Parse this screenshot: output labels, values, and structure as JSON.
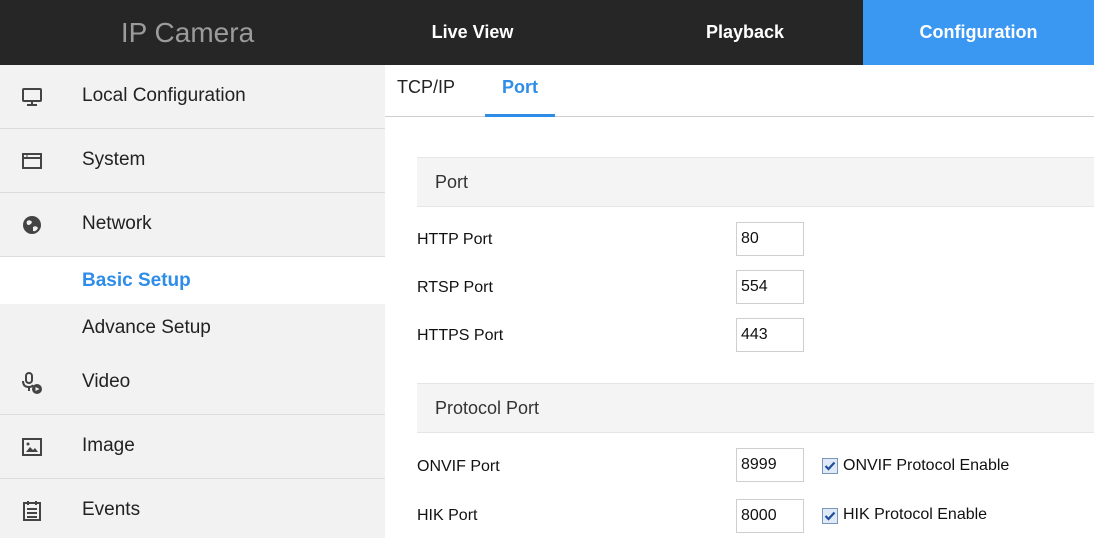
{
  "app": {
    "title": "IP Camera"
  },
  "topnav": {
    "live_view": "Live View",
    "playback": "Playback",
    "configuration": "Configuration"
  },
  "sidebar": {
    "items": [
      {
        "label": "Local Configuration",
        "icon": "monitor-icon"
      },
      {
        "label": "System",
        "icon": "window-icon"
      },
      {
        "label": "Network",
        "icon": "globe-icon"
      },
      {
        "label": "Video",
        "icon": "microphone-video-icon"
      },
      {
        "label": "Image",
        "icon": "image-icon"
      },
      {
        "label": "Events",
        "icon": "calendar-icon"
      }
    ],
    "network_sub": [
      {
        "label": "Basic Setup",
        "active": true
      },
      {
        "label": "Advance Setup",
        "active": false
      }
    ]
  },
  "tabs": [
    {
      "label": "TCP/IP",
      "active": false
    },
    {
      "label": "Port",
      "active": true
    }
  ],
  "port_section": {
    "title": "Port",
    "rows": [
      {
        "label": "HTTP Port",
        "value": "80"
      },
      {
        "label": "RTSP Port",
        "value": "554"
      },
      {
        "label": "HTTPS Port",
        "value": "443"
      }
    ]
  },
  "protocol_section": {
    "title": "Protocol Port",
    "rows": [
      {
        "label": "ONVIF Port",
        "value": "8999",
        "checkbox_label": "ONVIF Protocol Enable",
        "checked": true
      },
      {
        "label": "HIK Port",
        "value": "8000",
        "checkbox_label": "HIK Protocol Enable",
        "checked": true
      }
    ]
  },
  "colors": {
    "accent": "#3a97f2",
    "topbar": "#262626",
    "sidebar": "#f2f2f2"
  }
}
